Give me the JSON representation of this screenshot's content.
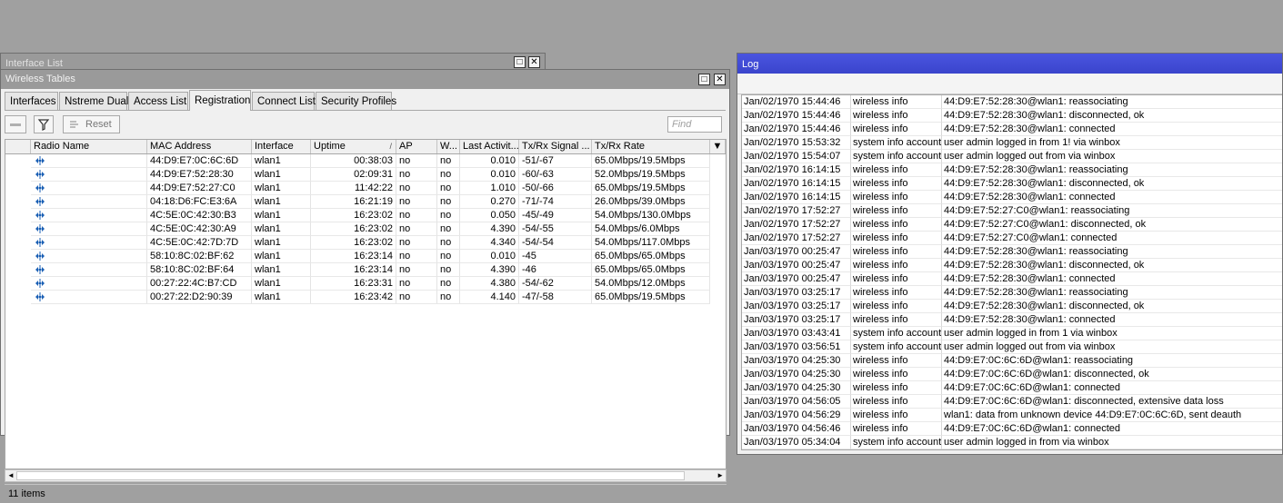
{
  "interface_window": {
    "title": "Interface List",
    "max_glyph": "□",
    "close_glyph": "✕"
  },
  "wireless_window": {
    "title": "Wireless Tables",
    "max_glyph": "□",
    "close_glyph": "✕",
    "tabs": [
      {
        "label": "Interfaces"
      },
      {
        "label": "Nstreme Dual"
      },
      {
        "label": "Access List"
      },
      {
        "label": "Registration",
        "active": true
      },
      {
        "label": "Connect List"
      },
      {
        "label": "Security Profiles"
      }
    ],
    "toolbar": {
      "reset_label": "Reset",
      "find_placeholder": "Find"
    },
    "columns": [
      "Radio Name",
      "MAC Address",
      "Interface",
      "Uptime",
      "AP",
      "W...",
      "Last Activit...",
      "Tx/Rx Signal ...",
      "Tx/Rx Rate"
    ],
    "sort_glyph": "/",
    "menu_glyph": "▼",
    "rows": [
      {
        "radio": "",
        "mac": "44:D9:E7:0C:6C:6D",
        "iface": "wlan1",
        "uptime": "00:38:03",
        "ap": "no",
        "wds": "no",
        "last": "0.010",
        "signal": "-51/-67",
        "rate": "65.0Mbps/19.5Mbps"
      },
      {
        "radio": "",
        "mac": "44:D9:E7:52:28:30",
        "iface": "wlan1",
        "uptime": "02:09:31",
        "ap": "no",
        "wds": "no",
        "last": "0.010",
        "signal": "-60/-63",
        "rate": "52.0Mbps/19.5Mbps"
      },
      {
        "radio": "",
        "mac": "44:D9:E7:52:27:C0",
        "iface": "wlan1",
        "uptime": "11:42:22",
        "ap": "no",
        "wds": "no",
        "last": "1.010",
        "signal": "-50/-66",
        "rate": "65.0Mbps/19.5Mbps"
      },
      {
        "radio": "",
        "mac": "04:18:D6:FC:E3:6A",
        "iface": "wlan1",
        "uptime": "16:21:19",
        "ap": "no",
        "wds": "no",
        "last": "0.270",
        "signal": "-71/-74",
        "rate": "26.0Mbps/39.0Mbps"
      },
      {
        "radio": "",
        "mac": "4C:5E:0C:42:30:B3",
        "iface": "wlan1",
        "uptime": "16:23:02",
        "ap": "no",
        "wds": "no",
        "last": "0.050",
        "signal": "-45/-49",
        "rate": "54.0Mbps/130.0Mbps"
      },
      {
        "radio": "",
        "mac": "4C:5E:0C:42:30:A9",
        "iface": "wlan1",
        "uptime": "16:23:02",
        "ap": "no",
        "wds": "no",
        "last": "4.390",
        "signal": "-54/-55",
        "rate": "54.0Mbps/6.0Mbps"
      },
      {
        "radio": "",
        "mac": "4C:5E:0C:42:7D:7D",
        "iface": "wlan1",
        "uptime": "16:23:02",
        "ap": "no",
        "wds": "no",
        "last": "4.340",
        "signal": "-54/-54",
        "rate": "54.0Mbps/117.0Mbps"
      },
      {
        "radio": "",
        "mac": "58:10:8C:02:BF:62",
        "iface": "wlan1",
        "uptime": "16:23:14",
        "ap": "no",
        "wds": "no",
        "last": "0.010",
        "signal": "-45",
        "rate": "65.0Mbps/65.0Mbps"
      },
      {
        "radio": "",
        "mac": "58:10:8C:02:BF:64",
        "iface": "wlan1",
        "uptime": "16:23:14",
        "ap": "no",
        "wds": "no",
        "last": "4.390",
        "signal": "-46",
        "rate": "65.0Mbps/65.0Mbps"
      },
      {
        "radio": "",
        "mac": "00:27:22:4C:B7:CD",
        "iface": "wlan1",
        "uptime": "16:23:31",
        "ap": "no",
        "wds": "no",
        "last": "4.380",
        "signal": "-54/-62",
        "rate": "54.0Mbps/12.0Mbps"
      },
      {
        "radio": "",
        "mac": "00:27:22:D2:90:39",
        "iface": "wlan1",
        "uptime": "16:23:42",
        "ap": "no",
        "wds": "no",
        "last": "4.140",
        "signal": "-47/-58",
        "rate": "65.0Mbps/19.5Mbps"
      }
    ],
    "status_text": "11 items",
    "scroll_left_glyph": "◄",
    "scroll_right_glyph": "►"
  },
  "log_window": {
    "title": "Log",
    "entries": [
      {
        "time": "Jan/02/1970 15:44:46",
        "topics": "wireless info",
        "msg": "44:D9:E7:52:28:30@wlan1: reassociating"
      },
      {
        "time": "Jan/02/1970 15:44:46",
        "topics": "wireless info",
        "msg": "44:D9:E7:52:28:30@wlan1: disconnected, ok"
      },
      {
        "time": "Jan/02/1970 15:44:46",
        "topics": "wireless info",
        "msg": "44:D9:E7:52:28:30@wlan1: connected"
      },
      {
        "time": "Jan/02/1970 15:53:32",
        "topics": "system info account",
        "msg": "user admin logged in from 1!                    via winbox"
      },
      {
        "time": "Jan/02/1970 15:54:07",
        "topics": "system info account",
        "msg": "user admin logged out from                        via winbox"
      },
      {
        "time": "Jan/02/1970 16:14:15",
        "topics": "wireless info",
        "msg": "44:D9:E7:52:28:30@wlan1: reassociating"
      },
      {
        "time": "Jan/02/1970 16:14:15",
        "topics": "wireless info",
        "msg": "44:D9:E7:52:28:30@wlan1: disconnected, ok"
      },
      {
        "time": "Jan/02/1970 16:14:15",
        "topics": "wireless info",
        "msg": "44:D9:E7:52:28:30@wlan1: connected"
      },
      {
        "time": "Jan/02/1970 17:52:27",
        "topics": "wireless info",
        "msg": "44:D9:E7:52:27:C0@wlan1: reassociating"
      },
      {
        "time": "Jan/02/1970 17:52:27",
        "topics": "wireless info",
        "msg": "44:D9:E7:52:27:C0@wlan1: disconnected, ok"
      },
      {
        "time": "Jan/02/1970 17:52:27",
        "topics": "wireless info",
        "msg": "44:D9:E7:52:27:C0@wlan1: connected"
      },
      {
        "time": "Jan/03/1970 00:25:47",
        "topics": "wireless info",
        "msg": "44:D9:E7:52:28:30@wlan1: reassociating"
      },
      {
        "time": "Jan/03/1970 00:25:47",
        "topics": "wireless info",
        "msg": "44:D9:E7:52:28:30@wlan1: disconnected, ok"
      },
      {
        "time": "Jan/03/1970 00:25:47",
        "topics": "wireless info",
        "msg": "44:D9:E7:52:28:30@wlan1: connected"
      },
      {
        "time": "Jan/03/1970 03:25:17",
        "topics": "wireless info",
        "msg": "44:D9:E7:52:28:30@wlan1: reassociating"
      },
      {
        "time": "Jan/03/1970 03:25:17",
        "topics": "wireless info",
        "msg": "44:D9:E7:52:28:30@wlan1: disconnected, ok"
      },
      {
        "time": "Jan/03/1970 03:25:17",
        "topics": "wireless info",
        "msg": "44:D9:E7:52:28:30@wlan1: connected"
      },
      {
        "time": "Jan/03/1970 03:43:41",
        "topics": "system info account",
        "msg": "user admin logged in from 1                       via winbox"
      },
      {
        "time": "Jan/03/1970 03:56:51",
        "topics": "system info account",
        "msg": "user admin logged out from                        via winbox"
      },
      {
        "time": "Jan/03/1970 04:25:30",
        "topics": "wireless info",
        "msg": "44:D9:E7:0C:6C:6D@wlan1: reassociating"
      },
      {
        "time": "Jan/03/1970 04:25:30",
        "topics": "wireless info",
        "msg": "44:D9:E7:0C:6C:6D@wlan1: disconnected, ok"
      },
      {
        "time": "Jan/03/1970 04:25:30",
        "topics": "wireless info",
        "msg": "44:D9:E7:0C:6C:6D@wlan1: connected"
      },
      {
        "time": "Jan/03/1970 04:56:05",
        "topics": "wireless info",
        "msg": "44:D9:E7:0C:6C:6D@wlan1: disconnected, extensive data loss"
      },
      {
        "time": "Jan/03/1970 04:56:29",
        "topics": "wireless info",
        "msg": "wlan1: data from unknown device 44:D9:E7:0C:6C:6D, sent deauth"
      },
      {
        "time": "Jan/03/1970 04:56:46",
        "topics": "wireless info",
        "msg": "44:D9:E7:0C:6C:6D@wlan1: connected"
      },
      {
        "time": "Jan/03/1970 05:34:04",
        "topics": "system info account",
        "msg": "user admin logged in from                         via winbox"
      }
    ]
  },
  "colors": {
    "desktop": "#a0a0a0",
    "log_title": "#3a44cc",
    "icon": "#1a5fb4"
  }
}
